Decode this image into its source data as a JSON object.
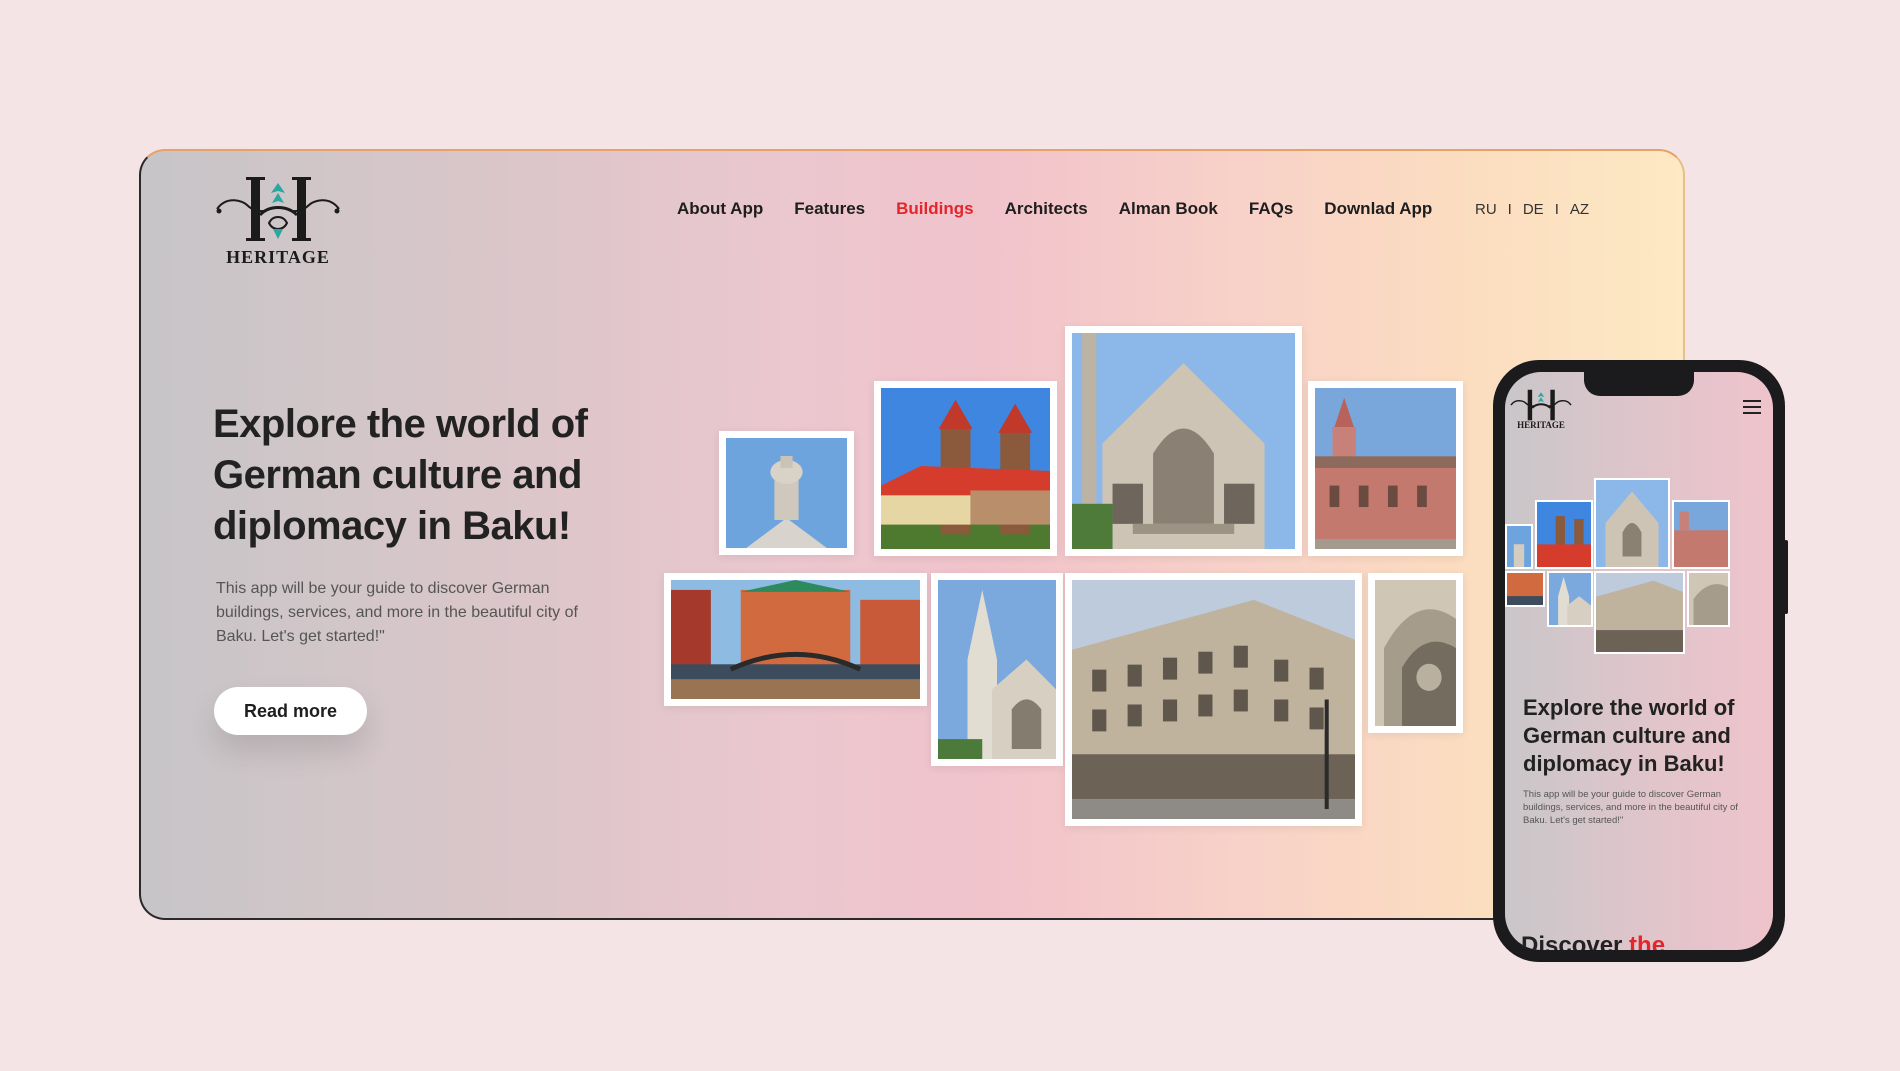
{
  "brand": {
    "name": "HERITAGE",
    "accent": "#e3262b",
    "logo_icon": "heritage-monogram-icon"
  },
  "nav": {
    "items": [
      {
        "label": "About App"
      },
      {
        "label": "Features"
      },
      {
        "label": "Buildings",
        "active": true
      },
      {
        "label": "Architects"
      },
      {
        "label": "Alman Book"
      },
      {
        "label": "FAQs"
      },
      {
        "label": "Downlad App"
      }
    ]
  },
  "languages": {
    "items": [
      "RU",
      "DE",
      "AZ"
    ],
    "separator": "I"
  },
  "hero": {
    "title": "Explore the world of German culture and diplomacy in Baku!",
    "description": "This app will be your guide to discover German buildings, services, and more in the beautiful city of Baku. Let's get started!\"",
    "cta_label": "Read more"
  },
  "gallery": {
    "photos": [
      "statue-detail-photo",
      "red-roof-castle-photo",
      "gothic-church-facade-photo",
      "brick-church-photo",
      "hamburg-canal-photo",
      "church-spire-photo",
      "baku-street-building-photo",
      "arched-portal-photo"
    ]
  },
  "mobile": {
    "brand": "HERITAGE",
    "menu_icon": "hamburger-menu-icon",
    "title": "Explore the world of German culture and diplomacy in Baku!",
    "description": "This app will be your guide to discover German buildings, services, and more in the beautiful city of Baku. Let's get started!\"",
    "next_heading_1": "Discover",
    "next_heading_2": " the"
  }
}
